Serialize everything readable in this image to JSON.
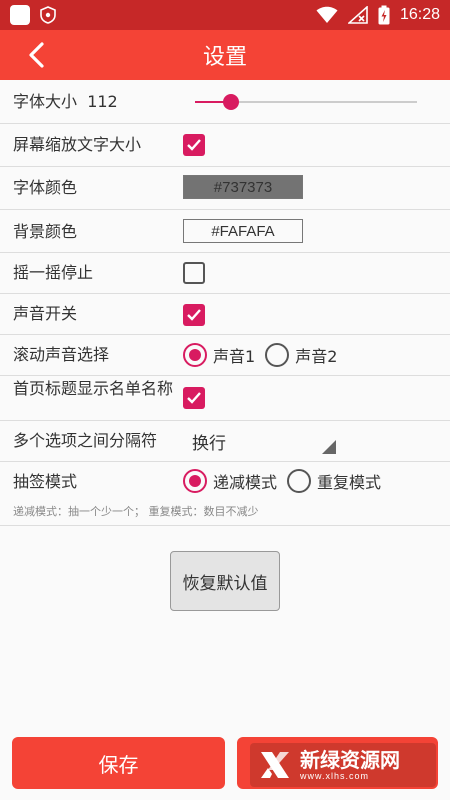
{
  "status_bar": {
    "time": "16:28"
  },
  "app_bar": {
    "title": "设置"
  },
  "settings": {
    "font_size_label": "字体大小",
    "font_size_value": "112",
    "font_size_level": 0.16,
    "scale_text_label": "屏幕缩放文字大小",
    "font_color_label": "字体颜色",
    "font_color_value": "#737373",
    "bg_color_label": "背景颜色",
    "bg_color_value": "#FAFAFA",
    "shake_stop_label": "摇一摇停止",
    "sound_switch_label": "声音开关",
    "scroll_sound_label": "滚动声音选择",
    "sound_options": [
      "声音1",
      "声音2"
    ],
    "show_list_name_label": "首页标题显示名单名称",
    "separator_label": "多个选项之间分隔符",
    "separator_value": "换行",
    "draw_mode_label": "抽签模式",
    "draw_mode_options": [
      "递减模式",
      "重复模式"
    ],
    "draw_mode_hint": "递减模式：抽一个少一个；  重复模式：数目不减少"
  },
  "buttons": {
    "restore_default": "恢复默认值",
    "save": "保存"
  },
  "watermark": {
    "name": "新绿资源网",
    "site": "www.xlhs.com"
  },
  "colors": {
    "accent": "#d81b60",
    "app_bar": "#f44336",
    "status_bar": "#c62828"
  }
}
